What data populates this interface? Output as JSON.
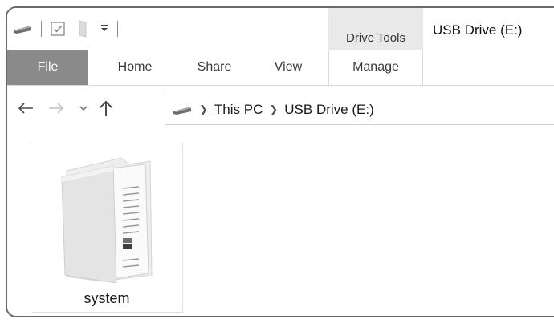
{
  "titlebar": {
    "contextual_tab": "Drive Tools",
    "window_title": "USB Drive (E:)",
    "qat_icons": [
      "drive-icon",
      "properties-checkbox-icon",
      "new-folder-icon",
      "customize-dropdown-icon"
    ]
  },
  "ribbon": {
    "tabs": [
      {
        "label": "File"
      },
      {
        "label": "Home"
      },
      {
        "label": "Share"
      },
      {
        "label": "View"
      },
      {
        "label": "Manage"
      }
    ]
  },
  "navigation": {
    "breadcrumb": [
      "This PC",
      "USB Drive (E:)"
    ]
  },
  "content": {
    "items": [
      {
        "name": "system",
        "type": "folder"
      }
    ]
  }
}
